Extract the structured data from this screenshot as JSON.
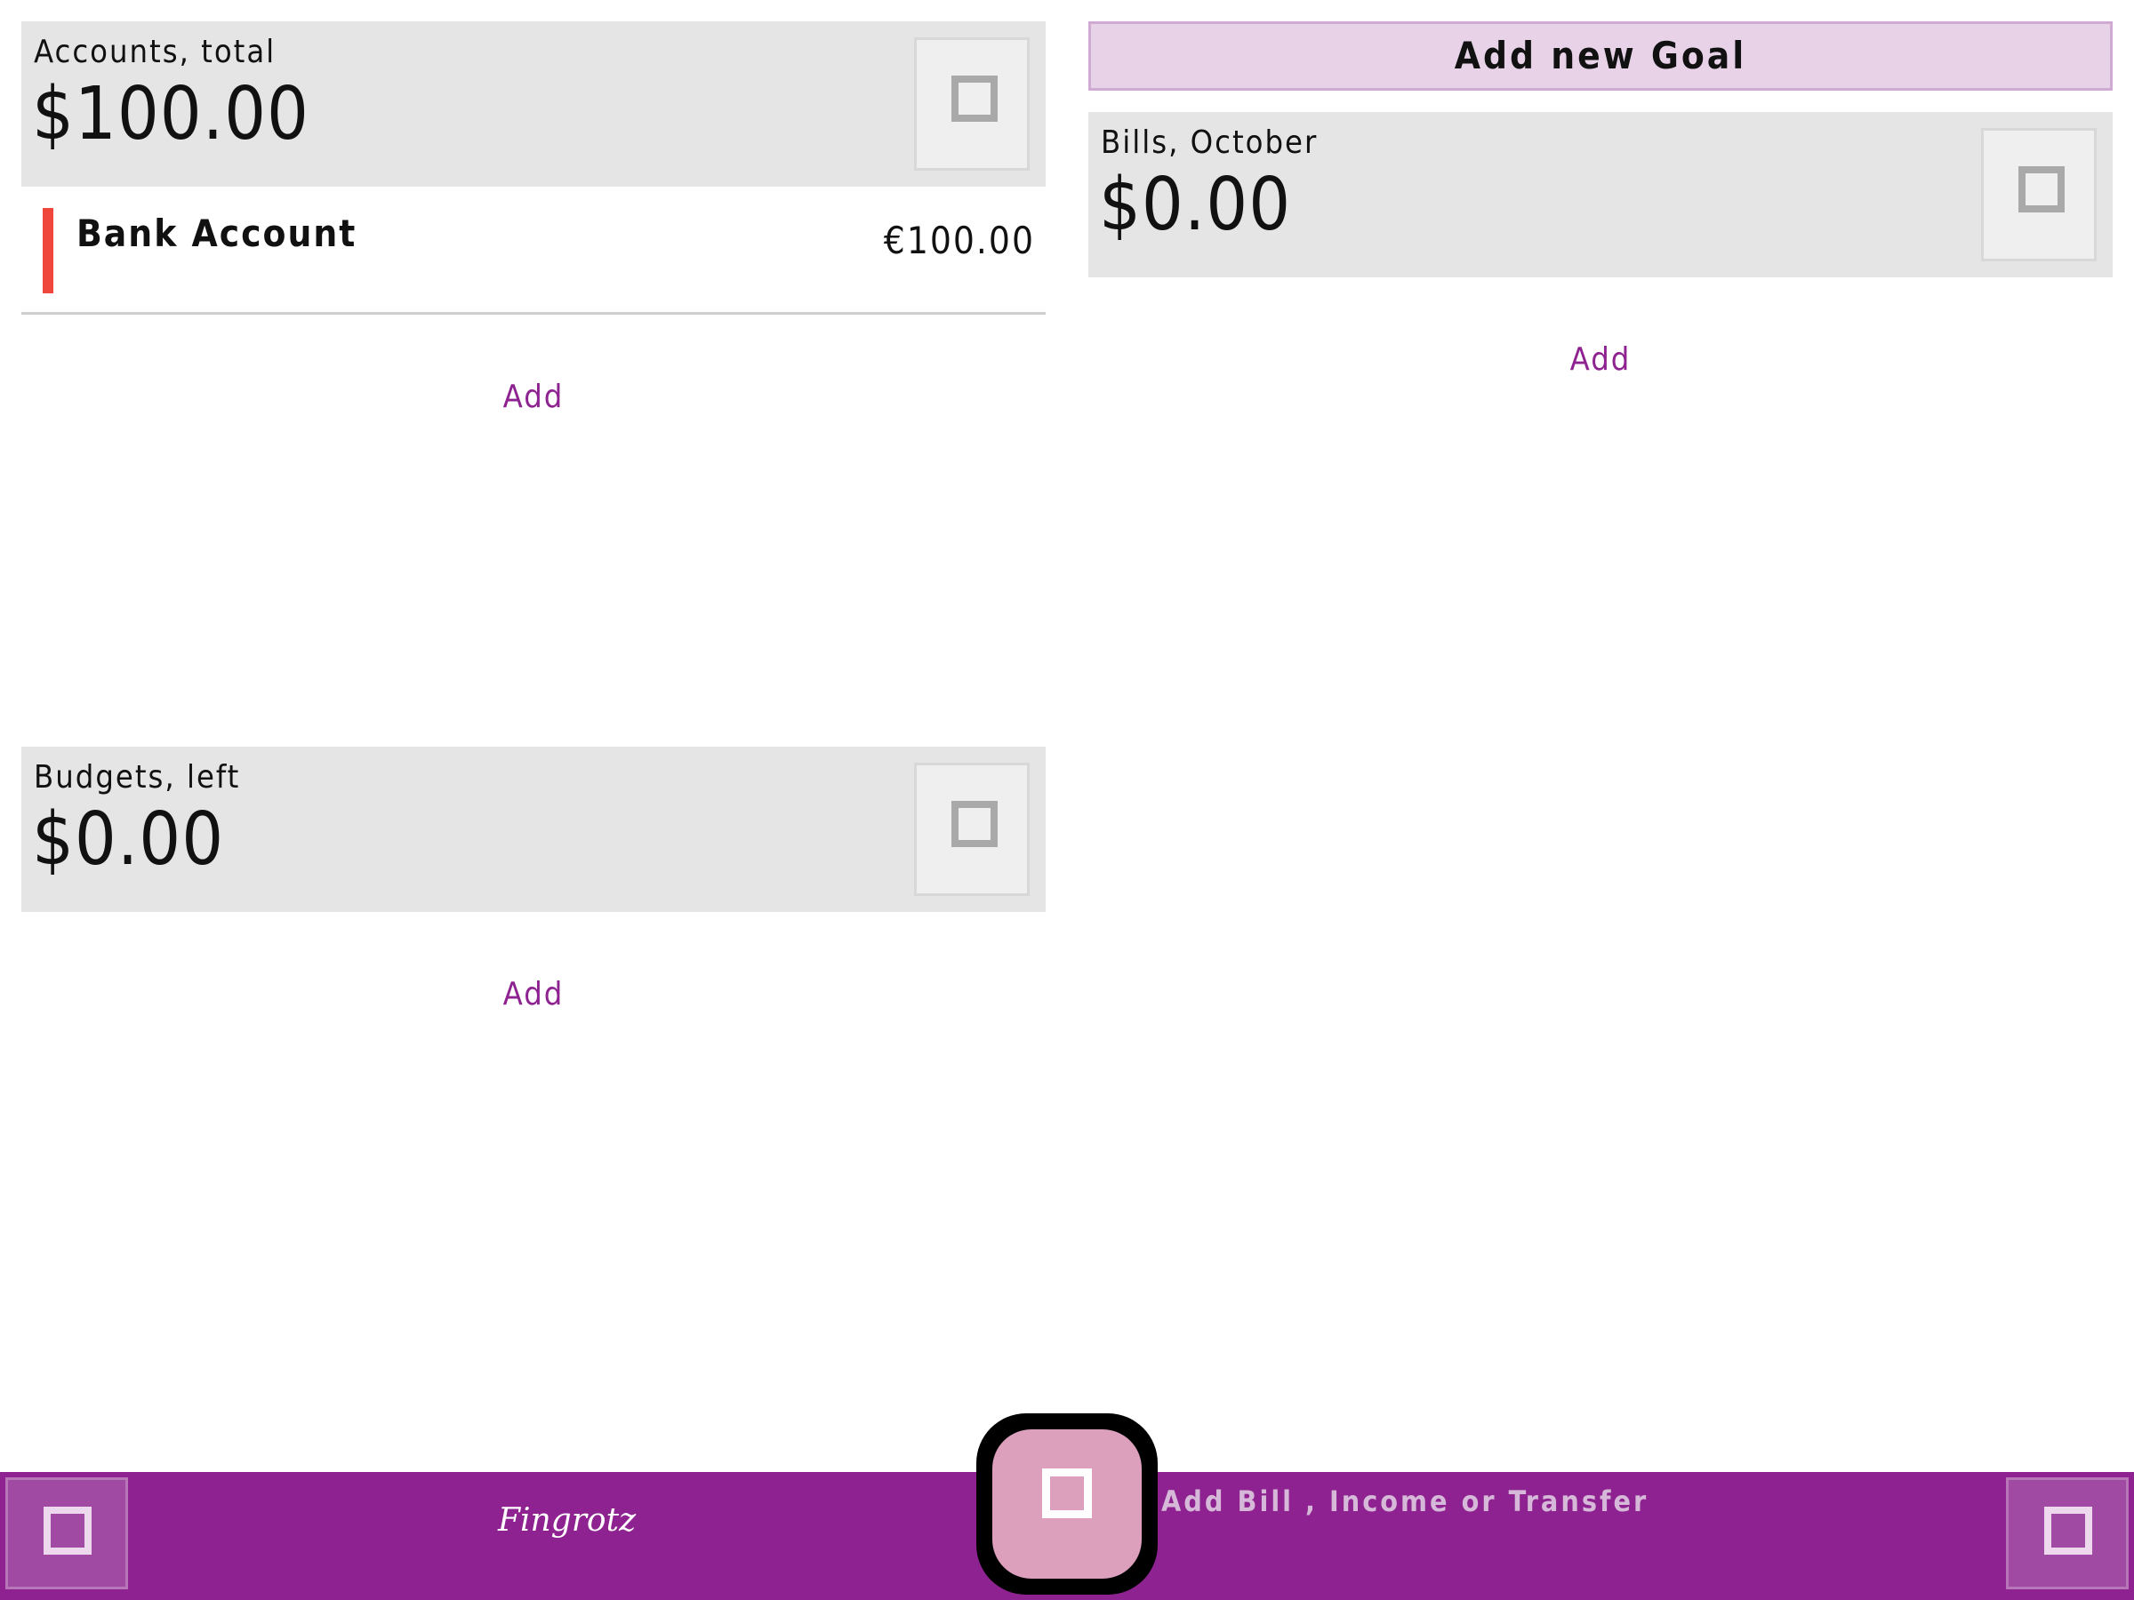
{
  "accounts": {
    "title": "Accounts, total",
    "amount": "$100.00",
    "menu_icon": "menu-square-icon",
    "items": [
      {
        "name": "Bank Account",
        "balance": "€100.00",
        "color": "#f0473d"
      }
    ],
    "add_label": "Add"
  },
  "budgets": {
    "title": "Budgets, left",
    "amount": "$0.00",
    "menu_icon": "menu-square-icon",
    "add_label": "Add"
  },
  "goals": {
    "add_goal_label": "Add new Goal"
  },
  "bills": {
    "title": "Bills, October",
    "amount": "$0.00",
    "menu_icon": "menu-square-icon",
    "add_label": "Add"
  },
  "bottom_bar": {
    "logo": "Fingrotz",
    "caption": "Add Bill , Income or Transfer",
    "left_icon": "menu-icon",
    "right_icon": "overflow-icon",
    "fab_icon": "add-transaction-icon"
  },
  "colors": {
    "accent": "#8e2290",
    "card_bg": "#e5e5e5",
    "goal_bg": "#e8d2e8",
    "fab": "#dca0bd",
    "account_marker": "#f0473d"
  }
}
